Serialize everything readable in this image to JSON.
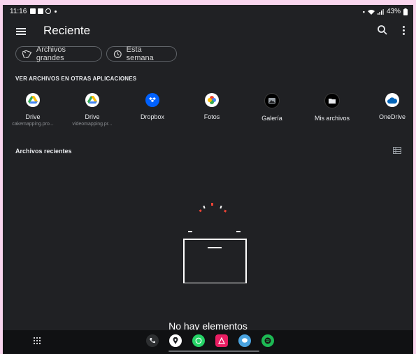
{
  "status_bar": {
    "time": "11:16",
    "battery": "43%"
  },
  "app_bar": {
    "title": "Reciente",
    "icons": [
      "menu-icon",
      "search-icon",
      "more-vert-icon"
    ]
  },
  "filters": [
    {
      "label": "Archivos grandes",
      "icon": "tag-icon"
    },
    {
      "label": "Esta semana",
      "icon": "history-icon"
    }
  ],
  "other_apps": {
    "heading": "VER ARCHIVOS EN OTRAS APLICACIONES",
    "items": [
      {
        "name": "Drive",
        "account": "cakemapping.pro...",
        "icon": "google-drive-icon"
      },
      {
        "name": "Drive",
        "account": "videomapping.pr...",
        "icon": "google-drive-icon"
      },
      {
        "name": "Dropbox",
        "account": "",
        "icon": "dropbox-icon"
      },
      {
        "name": "Fotos",
        "account": "",
        "icon": "google-photos-icon"
      },
      {
        "name": "Galería",
        "account": "",
        "icon": "gallery-icon"
      },
      {
        "name": "Mis archivos",
        "account": "",
        "icon": "folder-icon"
      },
      {
        "name": "OneDrive",
        "account": "",
        "icon": "onedrive-icon"
      }
    ]
  },
  "recent": {
    "heading": "Archivos recientes",
    "empty_message": "No hay elementos"
  },
  "dock": [
    "phone-icon",
    "maps-icon",
    "whatsapp-icon",
    "app-icon",
    "messages-icon",
    "spotify-icon"
  ],
  "colors": {
    "background": "#202124",
    "frame": "#f9d6ee",
    "accent_red": "#ea4335"
  }
}
